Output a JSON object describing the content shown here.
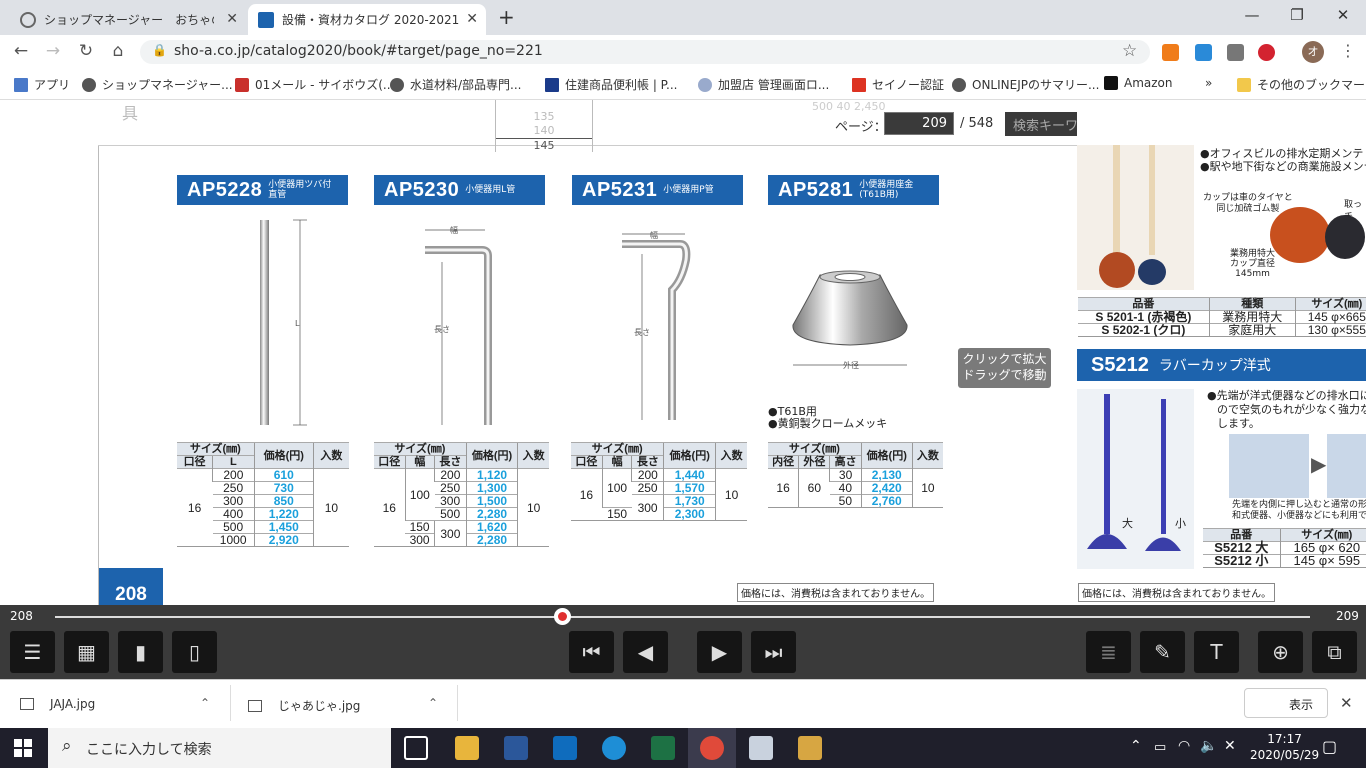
{
  "browser": {
    "tabs": [
      {
        "title": "ショップマネージャー　おちゃのこネット管",
        "active": false
      },
      {
        "title": "設備・資材カタログ 2020-2021",
        "active": true
      }
    ],
    "new_tab": "+",
    "window_controls": {
      "minimize": "—",
      "maximize": "❐",
      "close": "✕"
    },
    "url": "sho-a.co.jp/catalog2020/book/#target/page_no=221",
    "profile_initial": "オ",
    "bookmarks": [
      "アプリ",
      "ショップマネージャー...",
      "01メール - サイボウズ(...",
      "水道材料/部品専門...",
      "住建商品便利帳 | P...",
      "加盟店 管理画面ロ...",
      "セイノー認証",
      "ONLINEJPのサマリー...",
      "Amazon",
      "»",
      "その他のブックマーク"
    ]
  },
  "viewer": {
    "page_label": "ページ：",
    "page_current": "209",
    "page_total": "/ 548",
    "search_placeholder": "検索キーワードを入力",
    "hint": [
      "クリックで拡大",
      "ドラッグで移動"
    ],
    "left_page_number": "208",
    "tax_note": "価格には、消費税は含まれておりません。",
    "top_fragment": {
      "leftchar": "具",
      "sizes": [
        "135",
        "140",
        "145"
      ],
      "right": "500  40  2,450"
    }
  },
  "products": [
    {
      "code": "AP5228",
      "desc": [
        "小便器用ツバ付",
        "直管"
      ],
      "dim_labels": [
        "L"
      ],
      "headers": {
        "group": "サイズ(㎜)",
        "cols": [
          "口径",
          "L"
        ],
        "price": "価格(円)",
        "qty": "入数"
      },
      "rows": [
        [
          "200",
          "610"
        ],
        [
          "250",
          "730"
        ],
        [
          "300",
          "850"
        ],
        [
          "400",
          "1,220"
        ],
        [
          "500",
          "1,450"
        ],
        [
          "1000",
          "2,920"
        ]
      ],
      "merged": {
        "size": "16",
        "qty": "10"
      }
    },
    {
      "code": "AP5230",
      "desc": [
        "小便器用L管"
      ],
      "dim_labels": [
        "幅",
        "長さ"
      ],
      "headers": {
        "group": "サイズ(㎜)",
        "cols": [
          "口径",
          "幅",
          "長さ"
        ],
        "price": "価格(円)",
        "qty": "入数"
      },
      "rows": [
        [
          "100",
          "200",
          "1,120"
        ],
        [
          "",
          "250",
          "1,300"
        ],
        [
          "",
          "300",
          "1,500"
        ],
        [
          "",
          "500",
          "2,280"
        ],
        [
          "150",
          "300",
          "1,620"
        ],
        [
          "300",
          "",
          "2,280"
        ]
      ],
      "merged": {
        "size": "16",
        "qty": "10"
      }
    },
    {
      "code": "AP5231",
      "desc": [
        "小便器用P管"
      ],
      "dim_labels": [
        "幅",
        "長さ"
      ],
      "headers": {
        "group": "サイズ(㎜)",
        "cols": [
          "口径",
          "幅",
          "長さ"
        ],
        "price": "価格(円)",
        "qty": "入数"
      },
      "rows": [
        [
          "100",
          "200",
          "1,440"
        ],
        [
          "",
          "250",
          "1,570"
        ],
        [
          "",
          "300",
          "1,730"
        ],
        [
          "150",
          "",
          "2,300"
        ]
      ],
      "merged": {
        "size": "16",
        "qty": "10"
      }
    },
    {
      "code": "AP5281",
      "desc": [
        "小便器用座金",
        "(T61B用)"
      ],
      "dim_labels": [
        "外径"
      ],
      "notes": [
        "●T61B用",
        "●黄銅製クロームメッキ"
      ],
      "headers": {
        "group": "サイズ(㎜)",
        "cols": [
          "内径",
          "外径",
          "高さ"
        ],
        "price": "価格(円)",
        "qty": "入数"
      },
      "rows": [
        [
          "30",
          "2,130"
        ],
        [
          "40",
          "2,420"
        ],
        [
          "50",
          "2,760"
        ]
      ],
      "merged": {
        "inner": "16",
        "outer": "60",
        "qty": "10"
      }
    }
  ],
  "right_page": {
    "bullets": [
      "●オフィスビルの排水定期メンテ",
      "●駅や地下街などの商業施設メンテ"
    ],
    "callout1": [
      "カップは車のタイヤと",
      "同じ加硫ゴム製"
    ],
    "callout2": "取っ手",
    "callout3": [
      "業務用特大",
      "カップ直径",
      "145mm"
    ],
    "table1": {
      "headers": [
        "品番",
        "種類",
        "サイズ(㎜)"
      ],
      "rows": [
        [
          "S 5201-1 (赤褐色)",
          "業務用特大",
          "145 φ×665"
        ],
        [
          "S 5202-1 (クロ)",
          "家庭用大",
          "130 φ×555"
        ]
      ]
    },
    "s5212": {
      "code": "S5212",
      "title": "ラバーカップ洋式"
    },
    "bullet2": [
      "●先端が洋式便器などの排水口に",
      "ので空気のもれが少なく強力な",
      "します。"
    ],
    "labels_big_small": [
      "大",
      "小"
    ],
    "caption": [
      "先端を内側に押し込むと通常の形",
      "和式便器、小便器などにも利用で"
    ],
    "table2": {
      "headers": [
        "品番",
        "サイズ(㎜)"
      ],
      "rows": [
        [
          "S5212 大",
          "165 φ× 620"
        ],
        [
          "S5212 小",
          "145 φ× 595"
        ]
      ]
    }
  },
  "slider": {
    "left_label": "208",
    "right_label": "209",
    "position_fraction": 0.404
  },
  "downloads": {
    "items": [
      "JAJA.jpg",
      "じゃあじゃ.jpg"
    ],
    "show_all": "表示"
  },
  "taskbar": {
    "search_placeholder": "ここに入力して検索",
    "time": "17:17",
    "date": "2020/05/29"
  },
  "colors": {
    "accent_blue": "#1d63ad",
    "price_cyan": "#1aa0dc",
    "viewer_bar": "#3a3a3a"
  }
}
